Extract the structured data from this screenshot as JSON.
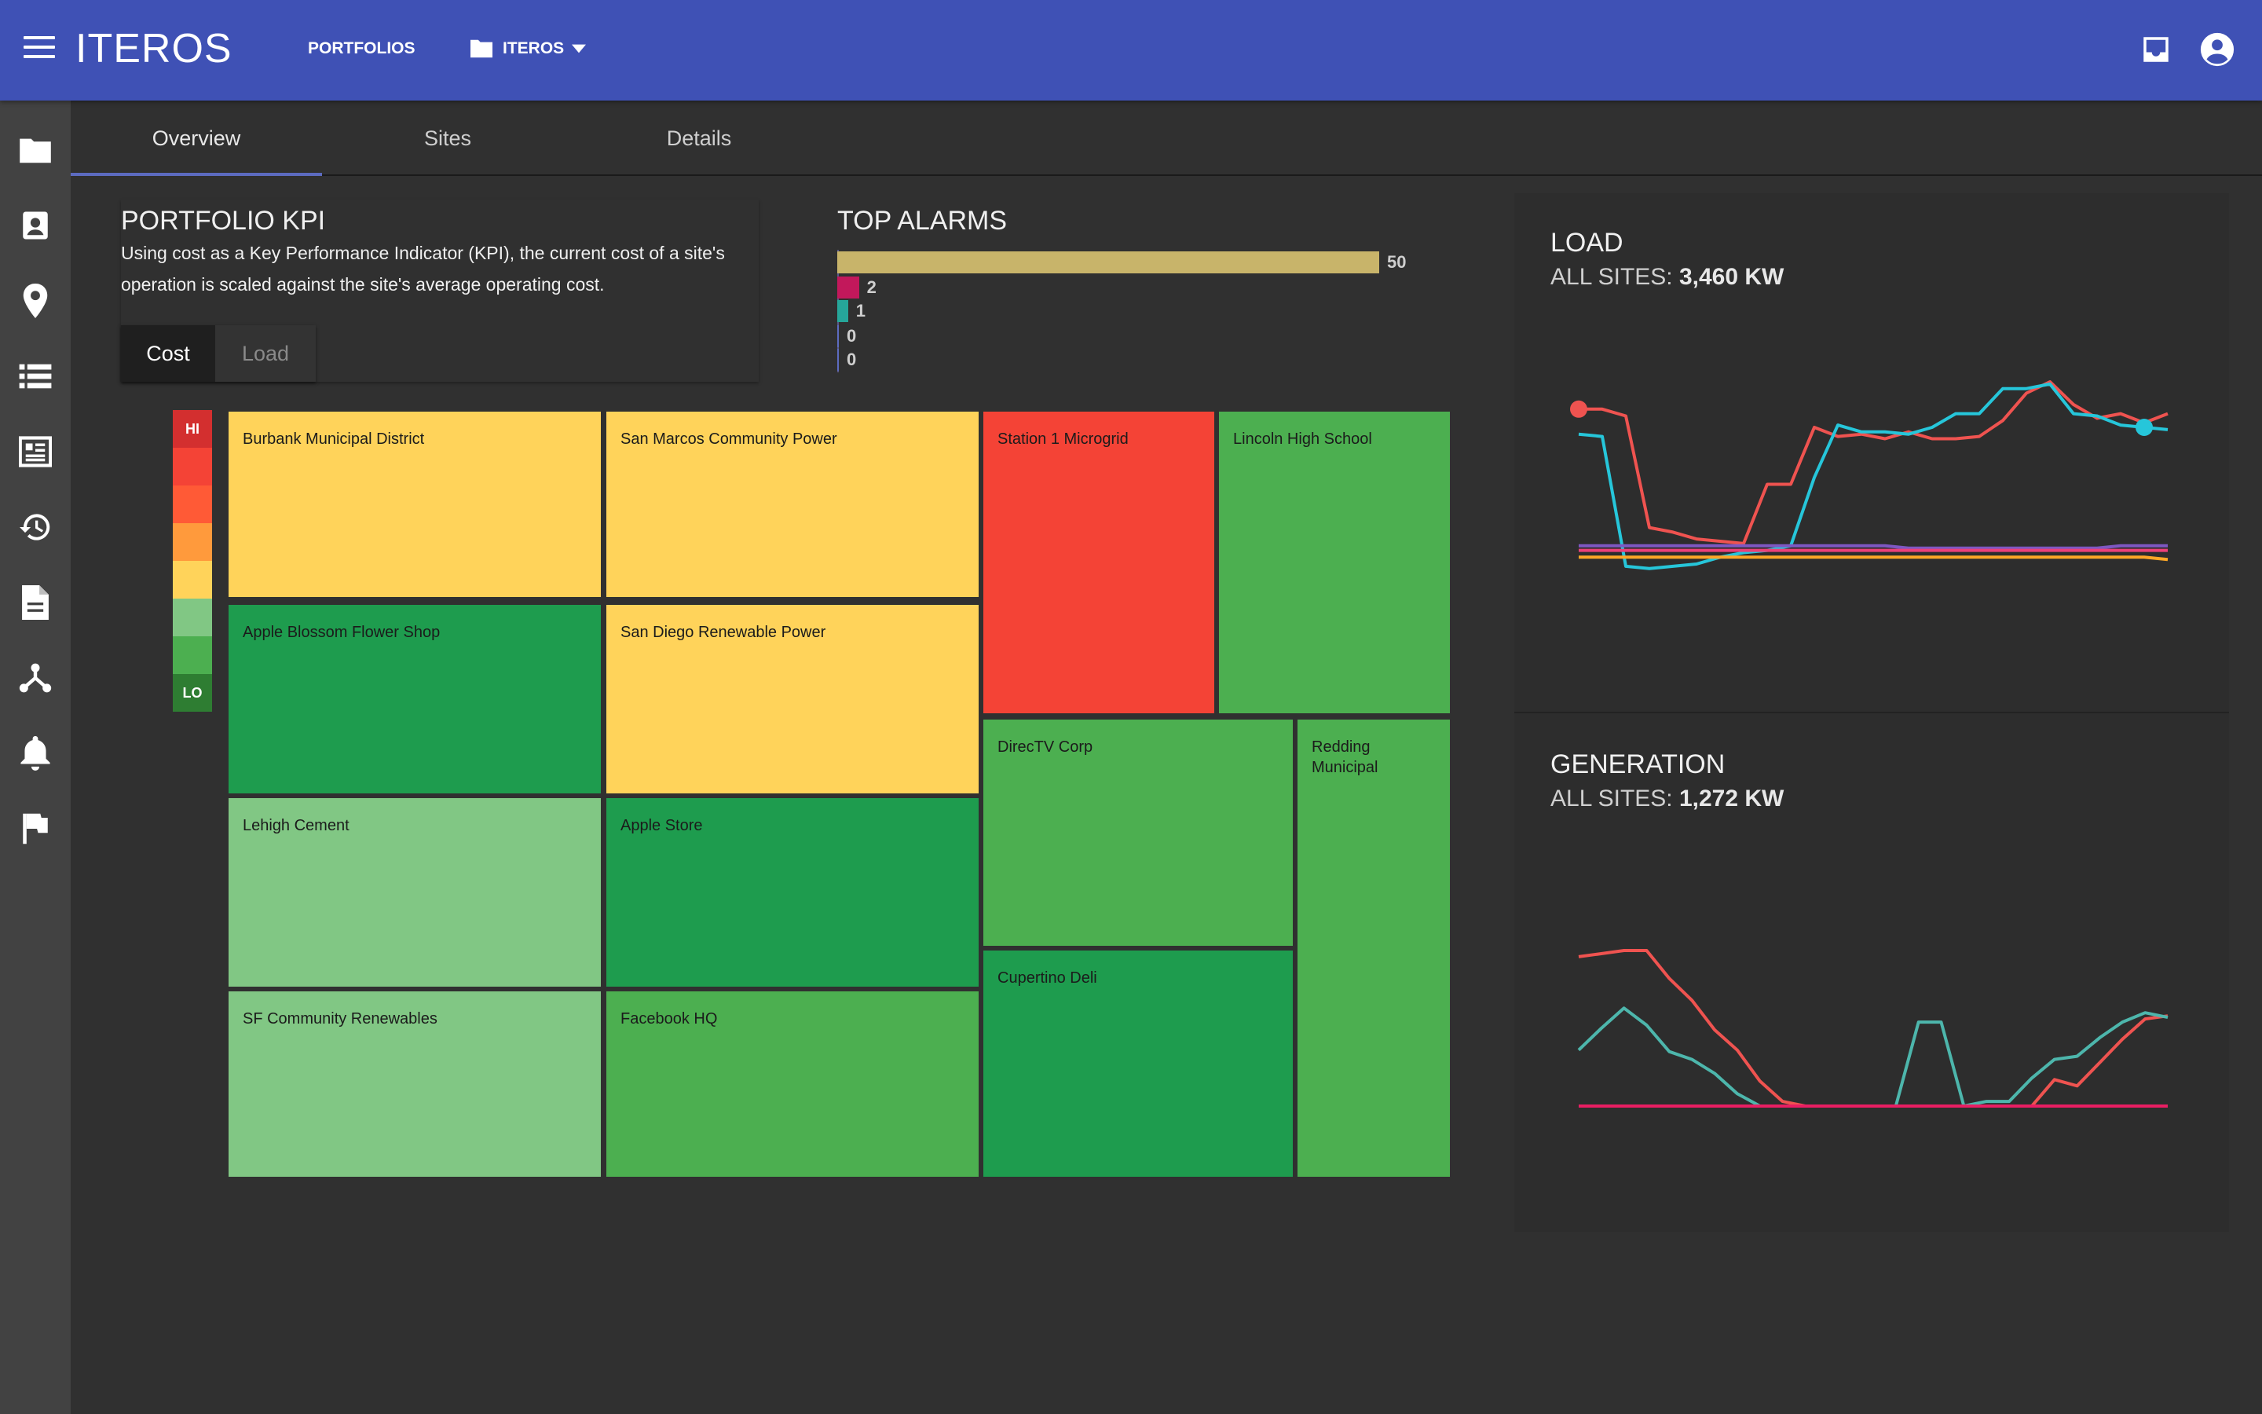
{
  "app": {
    "brand": "ITEROS",
    "nav_portfolios": "PORTFOLIOS",
    "portfolio_select": "ITEROS"
  },
  "tabs": [
    {
      "label": "Overview"
    },
    {
      "label": "Sites"
    },
    {
      "label": "Details"
    }
  ],
  "kpi": {
    "title": "PORTFOLIO KPI",
    "description": "Using cost as a Key Performance Indicator (KPI), the current cost of a site's operation is scaled against the site's average operating cost.",
    "toggle_cost": "Cost",
    "toggle_load": "Load"
  },
  "alarms": {
    "title": "TOP ALARMS",
    "items": [
      {
        "value": 50,
        "color": "#c8b46a"
      },
      {
        "value": 2,
        "color": "#c2185b"
      },
      {
        "value": 1,
        "color": "#26a69a"
      },
      {
        "value": 0,
        "color": "#5c6bc0"
      },
      {
        "value": 0,
        "color": "#5c6bc0"
      }
    ]
  },
  "legend": {
    "hi": "HI",
    "lo": "LO",
    "colors": [
      "#d32f2f",
      "#f44336",
      "#ff5a36",
      "#ff9a3c",
      "#ffd35a",
      "#81c784",
      "#4caf50",
      "#2e7d32"
    ]
  },
  "treemap": [
    {
      "name": "Burbank Municipal District",
      "color": "#ffd35a"
    },
    {
      "name": "San Marcos Community Power",
      "color": "#ffd35a"
    },
    {
      "name": "Station 1 Microgrid",
      "color": "#f44336"
    },
    {
      "name": "Lincoln High School",
      "color": "#4caf50"
    },
    {
      "name": "Apple Blossom Flower Shop",
      "color": "#1e9c4e"
    },
    {
      "name": "San Diego Renewable Power",
      "color": "#ffd35a"
    },
    {
      "name": "DirecTV Corp",
      "color": "#4caf50"
    },
    {
      "name": "Redding Municipal",
      "color": "#4caf50"
    },
    {
      "name": "Lehigh Cement",
      "color": "#81c784"
    },
    {
      "name": "Apple Store",
      "color": "#1e9c4e"
    },
    {
      "name": "Cupertino Deli",
      "color": "#1e9c4e"
    },
    {
      "name": "SF Community Renewables",
      "color": "#81c784"
    },
    {
      "name": "Facebook HQ",
      "color": "#4caf50"
    }
  ],
  "load": {
    "title": "LOAD",
    "sub_label": "ALL SITES:",
    "sub_value": "3,460 KW"
  },
  "generation": {
    "title": "GENERATION",
    "sub_label": "ALL SITES:",
    "sub_value": "1,272 KW"
  },
  "chart_data": [
    {
      "type": "line",
      "title": "LOAD",
      "ylim": [
        0,
        1
      ],
      "series": [
        {
          "color": "#ef5350",
          "values": [
            0.88,
            0.88,
            0.85,
            0.36,
            0.34,
            0.31,
            0.3,
            0.29,
            0.55,
            0.55,
            0.8,
            0.76,
            0.77,
            0.75,
            0.78,
            0.75,
            0.75,
            0.76,
            0.83,
            0.95,
            1.0,
            0.9,
            0.84,
            0.86,
            0.82,
            0.86
          ]
        },
        {
          "color": "#26c6da",
          "values": [
            0.77,
            0.76,
            0.19,
            0.18,
            0.19,
            0.2,
            0.23,
            0.25,
            0.26,
            0.28,
            0.58,
            0.81,
            0.78,
            0.78,
            0.77,
            0.8,
            0.86,
            0.86,
            0.97,
            0.97,
            0.99,
            0.86,
            0.85,
            0.81,
            0.8,
            0.79
          ]
        },
        {
          "color": "#7e57c2",
          "values": [
            0.28,
            0.28,
            0.28,
            0.28,
            0.28,
            0.28,
            0.28,
            0.28,
            0.28,
            0.28,
            0.28,
            0.28,
            0.28,
            0.28,
            0.27,
            0.27,
            0.27,
            0.27,
            0.27,
            0.27,
            0.27,
            0.27,
            0.27,
            0.28,
            0.28,
            0.28
          ]
        },
        {
          "color": "#ffa726",
          "values": [
            0.23,
            0.23,
            0.23,
            0.23,
            0.23,
            0.23,
            0.23,
            0.23,
            0.23,
            0.23,
            0.23,
            0.23,
            0.23,
            0.23,
            0.23,
            0.23,
            0.23,
            0.23,
            0.23,
            0.23,
            0.23,
            0.23,
            0.23,
            0.23,
            0.23,
            0.22
          ]
        },
        {
          "color": "#ec407a",
          "values": [
            0.26,
            0.26,
            0.26,
            0.26,
            0.26,
            0.26,
            0.26,
            0.26,
            0.26,
            0.26,
            0.26,
            0.26,
            0.26,
            0.26,
            0.26,
            0.26,
            0.26,
            0.26,
            0.26,
            0.26,
            0.26,
            0.26,
            0.26,
            0.26,
            0.26,
            0.26
          ]
        }
      ]
    },
    {
      "type": "line",
      "title": "GENERATION",
      "ylim": [
        0,
        1
      ],
      "series": [
        {
          "color": "#ef5350",
          "values": [
            0.96,
            0.98,
            1.0,
            1.0,
            0.82,
            0.68,
            0.49,
            0.36,
            0.16,
            0.03,
            0.0,
            0.0,
            0.0,
            0.0,
            0.0,
            0.0,
            0.0,
            0.0,
            0.0,
            0.0,
            0.0,
            0.17,
            0.13,
            0.28,
            0.43,
            0.56,
            0.58
          ]
        },
        {
          "color": "#4db6ac",
          "values": [
            0.36,
            0.5,
            0.63,
            0.52,
            0.35,
            0.3,
            0.21,
            0.08,
            0.0,
            0.0,
            0.0,
            0.0,
            0.0,
            0.0,
            0.0,
            0.54,
            0.54,
            0.0,
            0.03,
            0.03,
            0.18,
            0.3,
            0.32,
            0.44,
            0.54,
            0.6,
            0.57
          ]
        },
        {
          "color": "#e91e63",
          "values": [
            0,
            0,
            0,
            0,
            0,
            0,
            0,
            0,
            0,
            0,
            0,
            0,
            0,
            0,
            0,
            0,
            0,
            0,
            0,
            0,
            0,
            0,
            0,
            0,
            0,
            0,
            0
          ]
        }
      ]
    }
  ]
}
